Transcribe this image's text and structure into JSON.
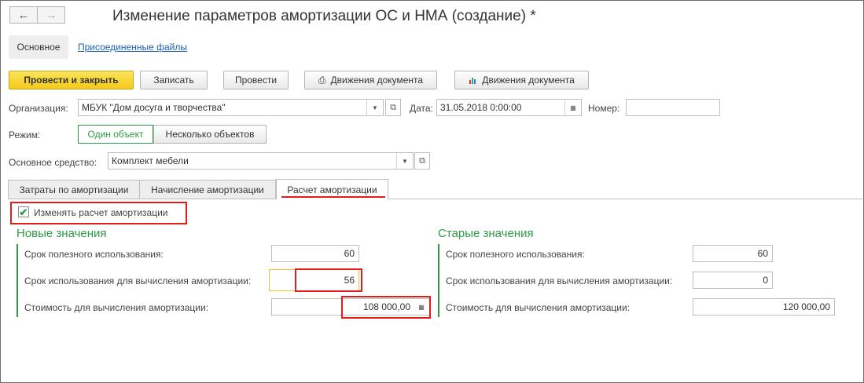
{
  "window": {
    "title": "Изменение параметров амортизации ОС и НМА (создание) *",
    "back_icon": "arrow-left",
    "forward_icon": "arrow-right"
  },
  "nav_tabs": [
    {
      "label": "Основное"
    },
    {
      "label": "Присоединенные файлы"
    }
  ],
  "toolbar": {
    "post_close_label": "Провести и закрыть",
    "save_label": "Записать",
    "post_label": "Провести",
    "movements_print_label": "Движения документа",
    "movements_report_label": "Движения документа"
  },
  "form": {
    "org_label": "Организация:",
    "org_value": "МБУК \"Дом досуга и творчества\"",
    "date_label": "Дата:",
    "date_value": "31.05.2018  0:00:00",
    "number_label": "Номер:",
    "number_value": "",
    "mode_label": "Режим:",
    "mode_options": [
      "Один объект",
      "Несколько объектов"
    ],
    "asset_label": "Основное средство:",
    "asset_value": "Комплект мебели"
  },
  "content_tabs": [
    {
      "label": "Затраты по амортизации"
    },
    {
      "label": "Начисление амортизации"
    },
    {
      "label": "Расчет амортизации"
    }
  ],
  "change_checkbox": {
    "label": "Изменять расчет амортизации",
    "checked": true
  },
  "new_values": {
    "title": "Новые значения",
    "useful_life_label": "Срок полезного использования:",
    "useful_life_value": "60",
    "calc_life_label": "Срок использования для вычисления амортизации:",
    "calc_life_value": "56",
    "cost_label": "Стоимость для вычисления амортизации:",
    "cost_value": "108 000,00"
  },
  "old_values": {
    "title": "Старые значения",
    "useful_life_label": "Срок полезного использования:",
    "useful_life_value": "60",
    "calc_life_label": "Срок использования для вычисления амортизации:",
    "calc_life_value": "0",
    "cost_label": "Стоимость для вычисления амортизации:",
    "cost_value": "120 000,00"
  },
  "colors": {
    "accent_green": "#2e9a45",
    "highlight_red": "#e41c1c",
    "primary_yellow": "#f4c91a"
  }
}
